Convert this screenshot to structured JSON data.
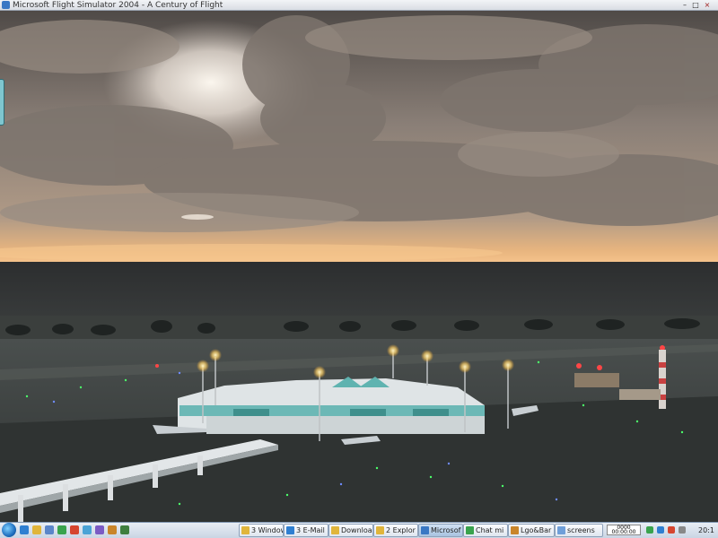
{
  "window": {
    "title": "Microsoft Flight Simulator 2004 - A Century of Flight",
    "minimize_glyph": "–",
    "maximize_glyph": "□",
    "close_glyph": "×"
  },
  "scene": {
    "description_icon": "flight-sim-viewport",
    "colors": {
      "sky_top": "#5a5552",
      "cloud": "#8d847c",
      "sunglow": "#f3c58e",
      "sea": "#2a2d2e",
      "ground": "#3e4342",
      "terminal": "#dfe4e6",
      "glass": "#5fb3b0"
    }
  },
  "taskbar": {
    "start_icon": "windows-orb-icon",
    "quick_launch": [
      "ie-icon",
      "folder-icon",
      "media-icon",
      "chrome-icon",
      "app-icon",
      "app-icon-2",
      "app-icon-3",
      "app-icon-4",
      "app-icon-5"
    ],
    "buttons": [
      {
        "label": "3 Window",
        "icon": "folder-icon"
      },
      {
        "label": "3 E-Mail",
        "icon": "mail-icon"
      },
      {
        "label": "Downloa",
        "icon": "download-icon"
      },
      {
        "label": "2 Explor",
        "icon": "explorer-icon"
      },
      {
        "label": "Microsof",
        "icon": "flight-sim-icon",
        "active": true
      },
      {
        "label": "Chat mi",
        "icon": "chat-icon"
      },
      {
        "label": "Lgo&Bar",
        "icon": "photo-icon"
      },
      {
        "label": "screens",
        "icon": "image-icon"
      }
    ],
    "tray": {
      "box_text_line1": "0000",
      "box_text_line2": "00:00:00",
      "clock": "20:1"
    }
  }
}
